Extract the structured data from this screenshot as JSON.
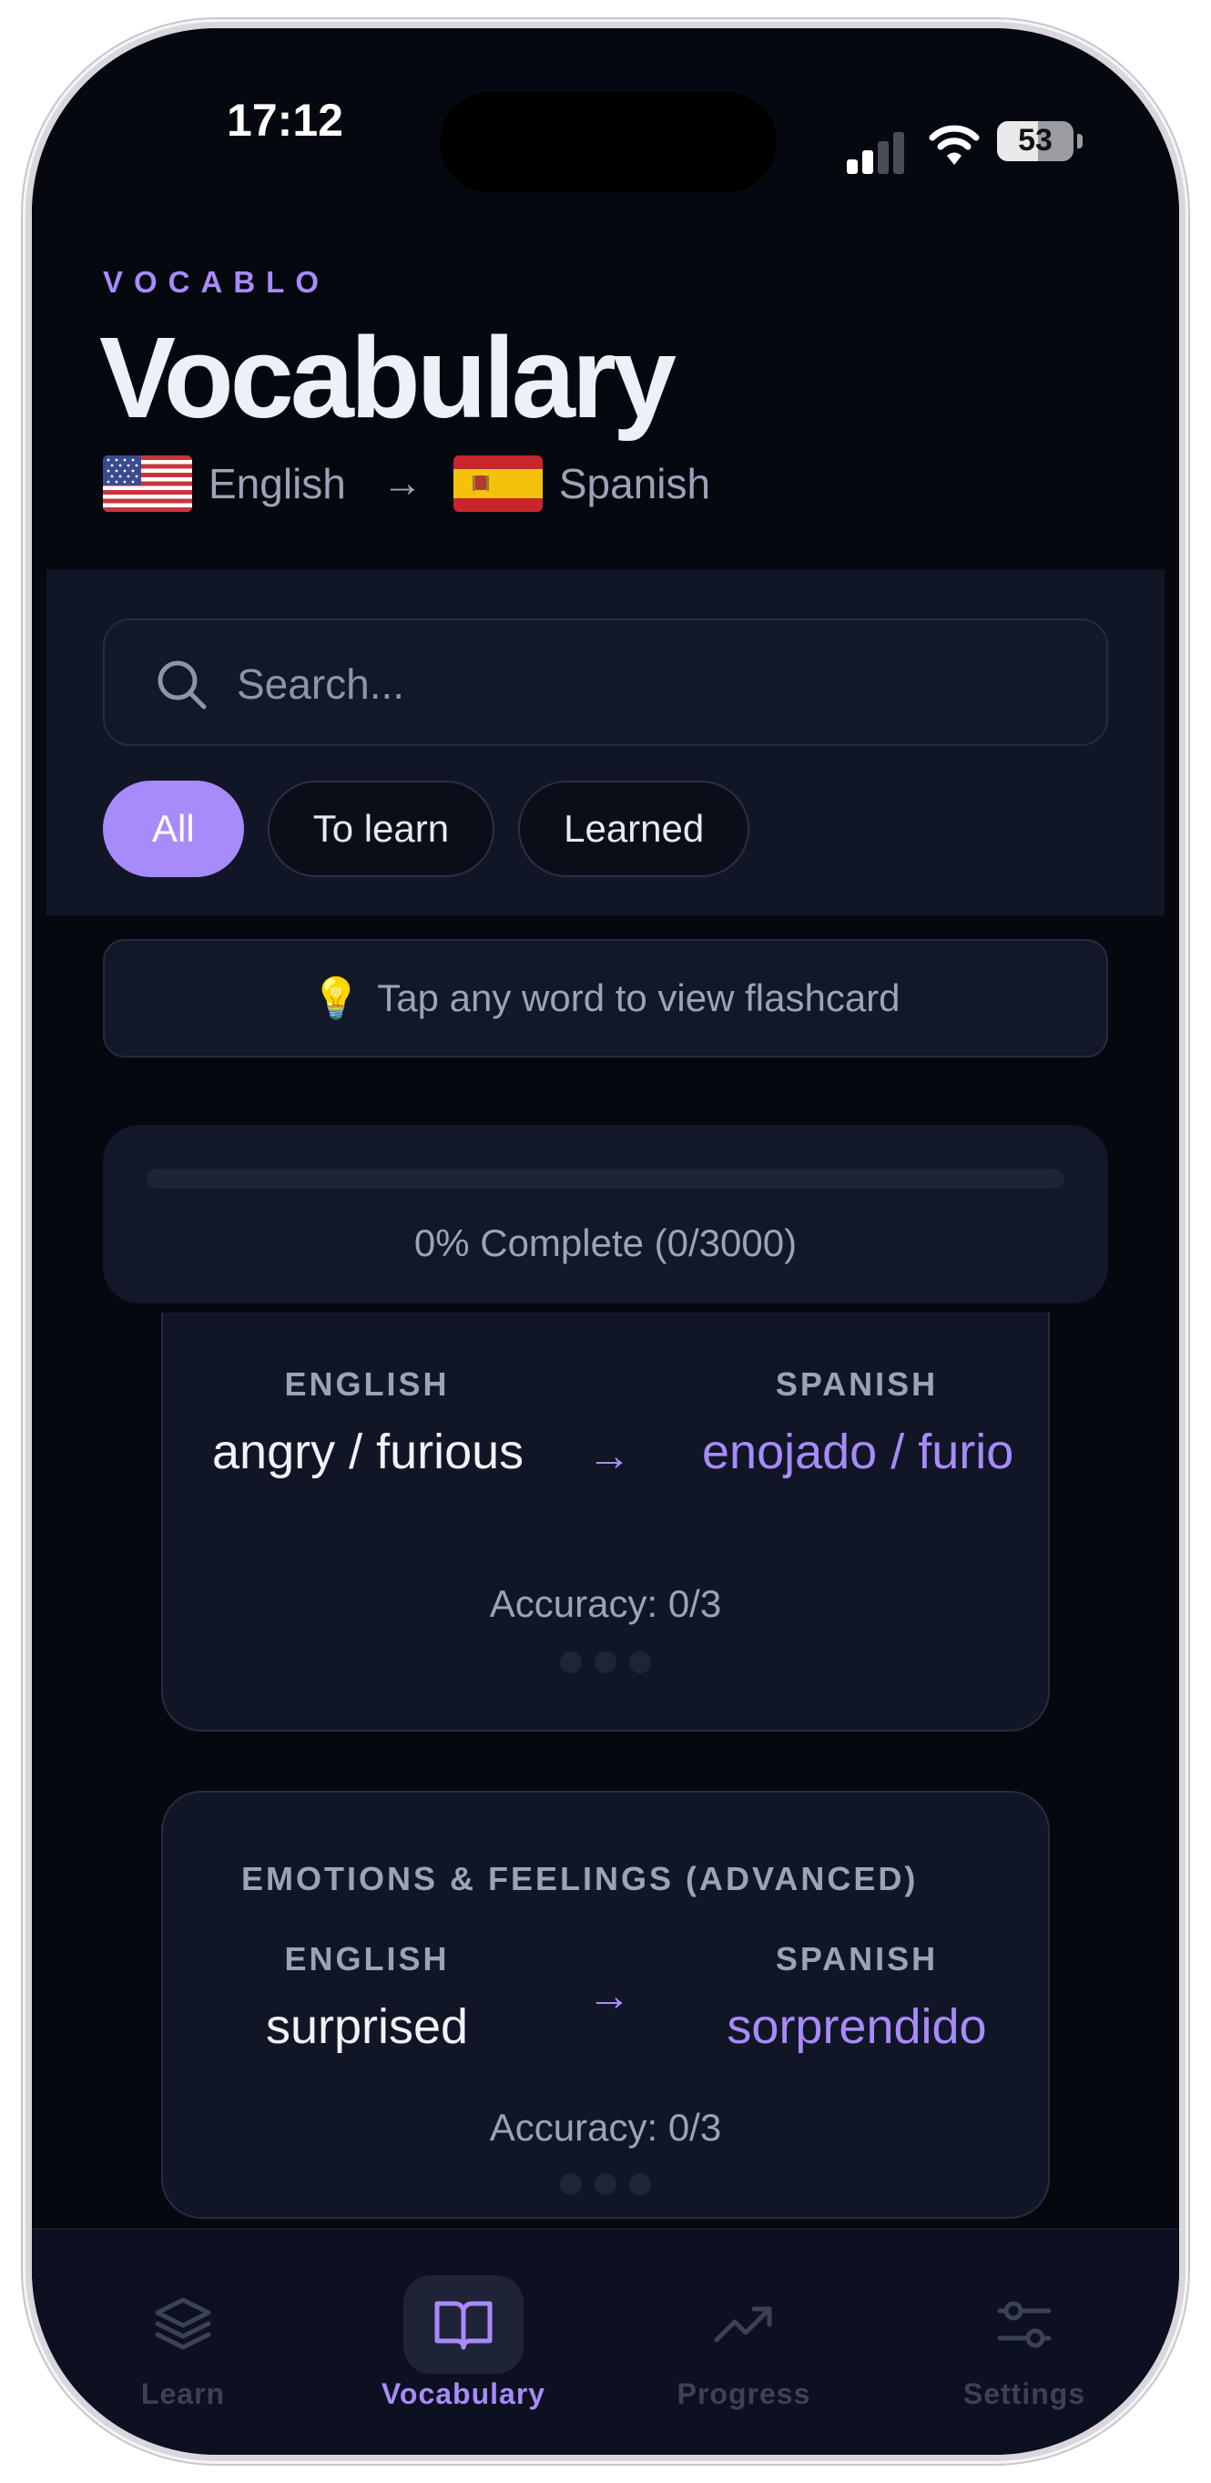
{
  "status_bar": {
    "time": "17:12",
    "battery": "53",
    "battery_level": 0.53,
    "signal_bars_active": 2,
    "icons": [
      "signal-icon",
      "wifi-icon",
      "battery-icon"
    ]
  },
  "header": {
    "brand": "VOCABLO",
    "title": "Vocabulary",
    "source_language": "English",
    "target_language": "Spanish",
    "source_flag": "us-flag-icon",
    "target_flag": "spain-flag-icon"
  },
  "search": {
    "placeholder": "Search...",
    "value": ""
  },
  "filters": [
    {
      "label": "All",
      "active": true
    },
    {
      "label": "To learn",
      "active": false
    },
    {
      "label": "Learned",
      "active": false
    }
  ],
  "hint": {
    "icon": "lightbulb-icon",
    "text": "Tap any word to view flashcard"
  },
  "progress": {
    "text": "0% Complete (0/3000)",
    "fraction": 0
  },
  "cards": [
    {
      "category": "",
      "source_head": "ENGLISH",
      "target_head": "SPANISH",
      "source_word": "angry / furious",
      "target_word": "enojado / furioso",
      "accuracy": "Accuracy: 0/3"
    },
    {
      "category": "EMOTIONS & FEELINGS (ADVANCED)",
      "source_head": "ENGLISH",
      "target_head": "SPANISH",
      "source_word": "surprised",
      "target_word": "sorprendido",
      "accuracy": "Accuracy: 0/3"
    }
  ],
  "tabs": [
    {
      "label": "Learn",
      "icon": "layers-icon",
      "active": false
    },
    {
      "label": "Vocabulary",
      "icon": "book-icon",
      "active": true
    },
    {
      "label": "Progress",
      "icon": "trending-up-icon",
      "active": false
    },
    {
      "label": "Settings",
      "icon": "sliders-icon",
      "active": false
    }
  ],
  "colors": {
    "accent": "#a78bfa",
    "background": "#06080f",
    "panel": "#111627",
    "muted_text": "#9aa3b8"
  }
}
